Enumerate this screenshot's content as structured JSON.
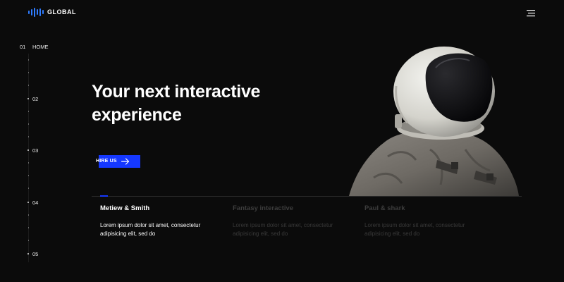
{
  "header": {
    "logo_text": "GLOBAL",
    "menu_icon": "hamburger-menu-icon"
  },
  "side_nav": {
    "items": [
      {
        "number": "01",
        "label": "HOME",
        "active": true
      },
      {
        "number": "02",
        "label": "",
        "active": false
      },
      {
        "number": "03",
        "label": "",
        "active": false
      },
      {
        "number": "04",
        "label": "",
        "active": false
      },
      {
        "number": "05",
        "label": "",
        "active": false
      }
    ]
  },
  "hero": {
    "title_line1": "Your next interactive",
    "title_line2": "experience",
    "cta_label": "HIRE US",
    "cta_icon": "arrow-right-icon"
  },
  "cards": [
    {
      "title": "Metiew & Smith",
      "text": "Lorem ipsum dolor sit amet, consectetur adipisicing elit, sed do",
      "active": true
    },
    {
      "title": "Fantasy interactive",
      "text": "Lorem ipsum dolor sit amet, consectetur adipisicing elit, sed do",
      "active": false
    },
    {
      "title": "Paul & shark",
      "text": "Lorem ipsum dolor sit amet, consectetur adipisicing elit, sed do",
      "active": false
    }
  ],
  "colors": {
    "background": "#0b0b0b",
    "accent": "#1538ff",
    "logo_accent": "#2f7cff",
    "text": "#ffffff",
    "muted_text": "#3a3a3a"
  }
}
